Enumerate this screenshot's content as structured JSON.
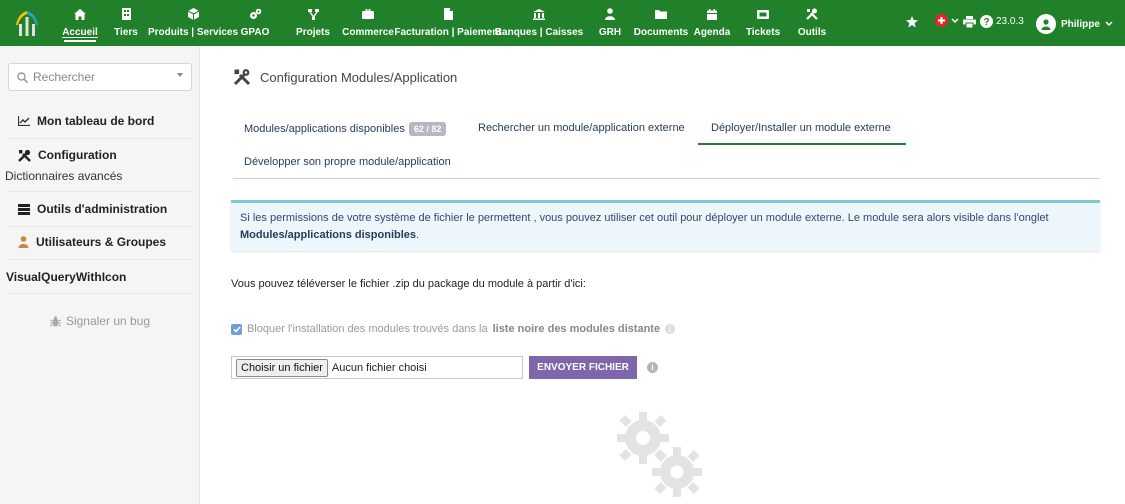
{
  "topmenu": {
    "items": [
      {
        "label": "Accueil",
        "icon": "home-icon",
        "active": true
      },
      {
        "label": "Tiers",
        "icon": "building-icon"
      },
      {
        "label": "Produits | Services",
        "icon": "cube-icon"
      },
      {
        "label": "GPAO",
        "icon": "cogs-icon"
      },
      {
        "label": "Projets",
        "icon": "sitemap-icon"
      },
      {
        "label": "Commerce",
        "icon": "briefcase-icon"
      },
      {
        "label": "Facturation | Paiement",
        "icon": "file-invoice-icon"
      },
      {
        "label": "Banques | Caisses",
        "icon": "bank-icon"
      },
      {
        "label": "GRH",
        "icon": "users-icon"
      },
      {
        "label": "Documents",
        "icon": "folder-icon"
      },
      {
        "label": "Agenda",
        "icon": "calendar-icon"
      },
      {
        "label": "Tickets",
        "icon": "ticket-icon"
      },
      {
        "label": "Outils",
        "icon": "tools-icon"
      }
    ],
    "version": "23.0.3",
    "user": "Philippe"
  },
  "sidebar": {
    "search_placeholder": "Rechercher",
    "items": [
      {
        "label": "Mon tableau de bord",
        "icon": "chart-line-icon"
      },
      {
        "label": "Configuration",
        "icon": "tools-icon"
      },
      {
        "label": "Dictionnaires avancés"
      },
      {
        "label": "Outils d'administration",
        "icon": "server-icon"
      },
      {
        "label": "Utilisateurs & Groupes",
        "icon": "user-icon"
      },
      {
        "label": "VisualQueryWithIcon"
      }
    ],
    "bug_label": "Signaler un bug"
  },
  "main": {
    "title": "Configuration Modules/Application",
    "tabs": [
      {
        "label": "Modules/applications disponibles",
        "badge": "62 / 82"
      },
      {
        "label": "Rechercher un module/application externe"
      },
      {
        "label": "Déployer/Installer un module externe",
        "active": true
      },
      {
        "label": "Développer son propre module/application"
      }
    ],
    "info_text": "Si les permissions de votre système de fichier le permettent , vous pouvez utiliser cet outil pour déployer un module externe. Le module sera alors visible dans l'onglet",
    "info_bold": "Modules/applications disponibles",
    "info_end": ".",
    "upload_text": "Vous pouvez téléverser le fichier .zip du package du module à partir d'ici:",
    "checkbox_text": "Bloquer l'installation des modules trouvés dans la",
    "checkbox_bold": "liste noire des modules distante",
    "file_button": "Choisir un fichier",
    "file_status": "Aucun fichier choisi",
    "send_button": "ENVOYER FICHIER"
  },
  "colors": {
    "topbar": "#21812a",
    "send_button": "#7d66ac",
    "info_bg": "#ecf6fb",
    "info_border": "#83c8d7"
  }
}
